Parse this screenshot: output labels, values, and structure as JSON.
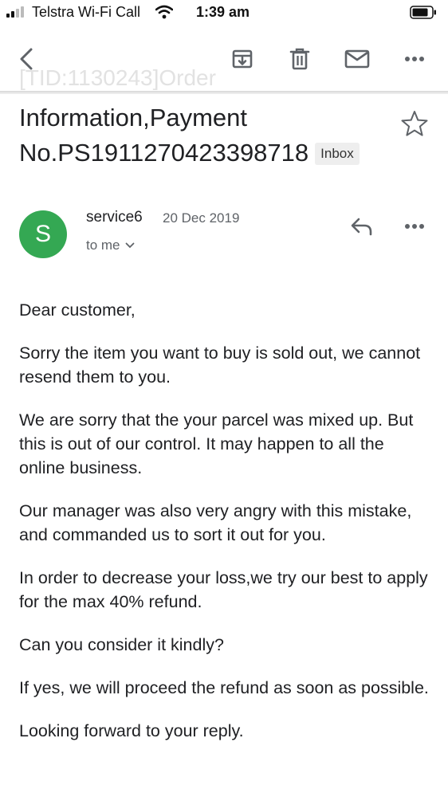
{
  "status_bar": {
    "carrier": "Telstra Wi-Fi Call",
    "time": "1:39 am",
    "icons": [
      "signal-icon",
      "wifi-icon",
      "battery-icon"
    ]
  },
  "toolbar": {
    "icons": [
      "back-arrow-icon",
      "archive-icon",
      "trash-icon",
      "mail-icon",
      "more-horizontal-icon"
    ]
  },
  "subject": {
    "ghost": "[TID:1130243]Order",
    "line1": "Information,Payment",
    "line2": "No.PS1911270423398718",
    "label": "Inbox"
  },
  "sender": {
    "initial": "S",
    "name": "service6",
    "date": "20 Dec 2019",
    "recipient": "to me",
    "avatar_color": "#34a853"
  },
  "body": {
    "paragraphs": [
      "Dear customer,",
      "Sorry the item you want to buy is sold out, we cannot resend them to you.",
      "We are sorry that the your parcel was mixed up. But this is out of our control. It may happen to all the online business.",
      "Our manager was also very angry with this mistake, and commanded us to sort it out for you.",
      "In order to decrease your loss,we try our best to apply for the max 40% refund.",
      "Can you consider it kindly?",
      "If yes, we will proceed the refund as soon as possible.",
      "Looking forward to your reply."
    ]
  }
}
